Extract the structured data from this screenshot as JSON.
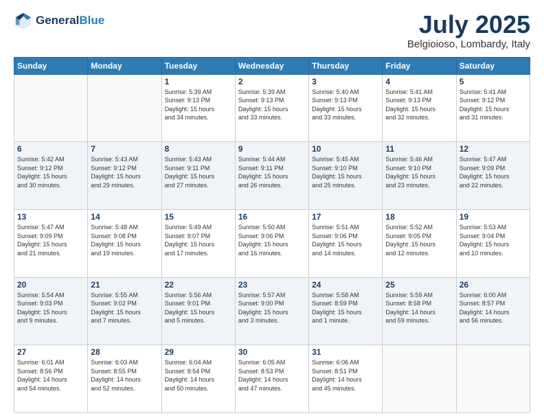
{
  "header": {
    "logo_line1": "General",
    "logo_line2": "Blue",
    "month": "July 2025",
    "location": "Belgioioso, Lombardy, Italy"
  },
  "weekdays": [
    "Sunday",
    "Monday",
    "Tuesday",
    "Wednesday",
    "Thursday",
    "Friday",
    "Saturday"
  ],
  "weeks": [
    [
      {
        "day": "",
        "info": ""
      },
      {
        "day": "",
        "info": ""
      },
      {
        "day": "1",
        "info": "Sunrise: 5:39 AM\nSunset: 9:13 PM\nDaylight: 15 hours\nand 34 minutes."
      },
      {
        "day": "2",
        "info": "Sunrise: 5:39 AM\nSunset: 9:13 PM\nDaylight: 15 hours\nand 33 minutes."
      },
      {
        "day": "3",
        "info": "Sunrise: 5:40 AM\nSunset: 9:13 PM\nDaylight: 15 hours\nand 33 minutes."
      },
      {
        "day": "4",
        "info": "Sunrise: 5:41 AM\nSunset: 9:13 PM\nDaylight: 15 hours\nand 32 minutes."
      },
      {
        "day": "5",
        "info": "Sunrise: 5:41 AM\nSunset: 9:12 PM\nDaylight: 15 hours\nand 31 minutes."
      }
    ],
    [
      {
        "day": "6",
        "info": "Sunrise: 5:42 AM\nSunset: 9:12 PM\nDaylight: 15 hours\nand 30 minutes."
      },
      {
        "day": "7",
        "info": "Sunrise: 5:43 AM\nSunset: 9:12 PM\nDaylight: 15 hours\nand 29 minutes."
      },
      {
        "day": "8",
        "info": "Sunrise: 5:43 AM\nSunset: 9:11 PM\nDaylight: 15 hours\nand 27 minutes."
      },
      {
        "day": "9",
        "info": "Sunrise: 5:44 AM\nSunset: 9:11 PM\nDaylight: 15 hours\nand 26 minutes."
      },
      {
        "day": "10",
        "info": "Sunrise: 5:45 AM\nSunset: 9:10 PM\nDaylight: 15 hours\nand 25 minutes."
      },
      {
        "day": "11",
        "info": "Sunrise: 5:46 AM\nSunset: 9:10 PM\nDaylight: 15 hours\nand 23 minutes."
      },
      {
        "day": "12",
        "info": "Sunrise: 5:47 AM\nSunset: 9:09 PM\nDaylight: 15 hours\nand 22 minutes."
      }
    ],
    [
      {
        "day": "13",
        "info": "Sunrise: 5:47 AM\nSunset: 9:09 PM\nDaylight: 15 hours\nand 21 minutes."
      },
      {
        "day": "14",
        "info": "Sunrise: 5:48 AM\nSunset: 9:08 PM\nDaylight: 15 hours\nand 19 minutes."
      },
      {
        "day": "15",
        "info": "Sunrise: 5:49 AM\nSunset: 9:07 PM\nDaylight: 15 hours\nand 17 minutes."
      },
      {
        "day": "16",
        "info": "Sunrise: 5:50 AM\nSunset: 9:06 PM\nDaylight: 15 hours\nand 16 minutes."
      },
      {
        "day": "17",
        "info": "Sunrise: 5:51 AM\nSunset: 9:06 PM\nDaylight: 15 hours\nand 14 minutes."
      },
      {
        "day": "18",
        "info": "Sunrise: 5:52 AM\nSunset: 9:05 PM\nDaylight: 15 hours\nand 12 minutes."
      },
      {
        "day": "19",
        "info": "Sunrise: 5:53 AM\nSunset: 9:04 PM\nDaylight: 15 hours\nand 10 minutes."
      }
    ],
    [
      {
        "day": "20",
        "info": "Sunrise: 5:54 AM\nSunset: 9:03 PM\nDaylight: 15 hours\nand 9 minutes."
      },
      {
        "day": "21",
        "info": "Sunrise: 5:55 AM\nSunset: 9:02 PM\nDaylight: 15 hours\nand 7 minutes."
      },
      {
        "day": "22",
        "info": "Sunrise: 5:56 AM\nSunset: 9:01 PM\nDaylight: 15 hours\nand 5 minutes."
      },
      {
        "day": "23",
        "info": "Sunrise: 5:57 AM\nSunset: 9:00 PM\nDaylight: 15 hours\nand 3 minutes."
      },
      {
        "day": "24",
        "info": "Sunrise: 5:58 AM\nSunset: 8:59 PM\nDaylight: 15 hours\nand 1 minute."
      },
      {
        "day": "25",
        "info": "Sunrise: 5:59 AM\nSunset: 8:58 PM\nDaylight: 14 hours\nand 59 minutes."
      },
      {
        "day": "26",
        "info": "Sunrise: 6:00 AM\nSunset: 8:57 PM\nDaylight: 14 hours\nand 56 minutes."
      }
    ],
    [
      {
        "day": "27",
        "info": "Sunrise: 6:01 AM\nSunset: 8:56 PM\nDaylight: 14 hours\nand 54 minutes."
      },
      {
        "day": "28",
        "info": "Sunrise: 6:03 AM\nSunset: 8:55 PM\nDaylight: 14 hours\nand 52 minutes."
      },
      {
        "day": "29",
        "info": "Sunrise: 6:04 AM\nSunset: 8:54 PM\nDaylight: 14 hours\nand 50 minutes."
      },
      {
        "day": "30",
        "info": "Sunrise: 6:05 AM\nSunset: 8:53 PM\nDaylight: 14 hours\nand 47 minutes."
      },
      {
        "day": "31",
        "info": "Sunrise: 6:06 AM\nSunset: 8:51 PM\nDaylight: 14 hours\nand 45 minutes."
      },
      {
        "day": "",
        "info": ""
      },
      {
        "day": "",
        "info": ""
      }
    ]
  ]
}
